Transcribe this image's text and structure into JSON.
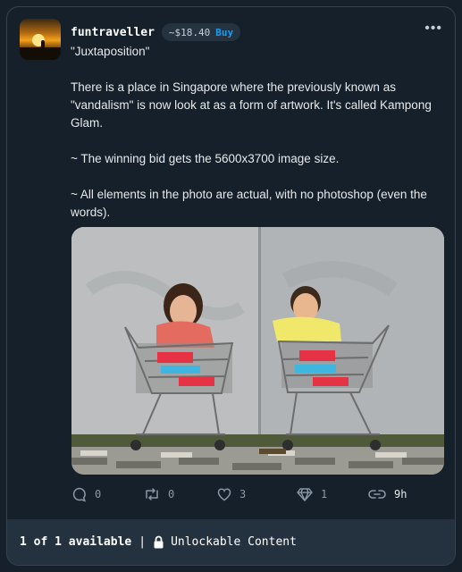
{
  "post": {
    "username": "funtraveller",
    "price": "~$18.40",
    "buy_label": "Buy",
    "more": "•••",
    "text": [
      "\"Juxtaposition\"",
      "There is a place in Singapore where the previously known as \"vandalism\" is now look at as a form of artwork. It's called Kampong Glam.",
      "~ The winning bid gets the 5600x3700 image size.",
      "~ All elements in the photo are actual, with no photoshop (even the words)."
    ]
  },
  "actions": {
    "replies": "0",
    "reposts": "0",
    "likes": "3",
    "gems": "1",
    "time": "9h"
  },
  "footer": {
    "availability": "1 of 1 available",
    "separator": "|",
    "unlockable": "Unlockable Content"
  },
  "icons": [
    "comment-icon",
    "repost-icon",
    "heart-icon",
    "diamond-icon",
    "link-icon",
    "lock-icon",
    "more-icon"
  ]
}
